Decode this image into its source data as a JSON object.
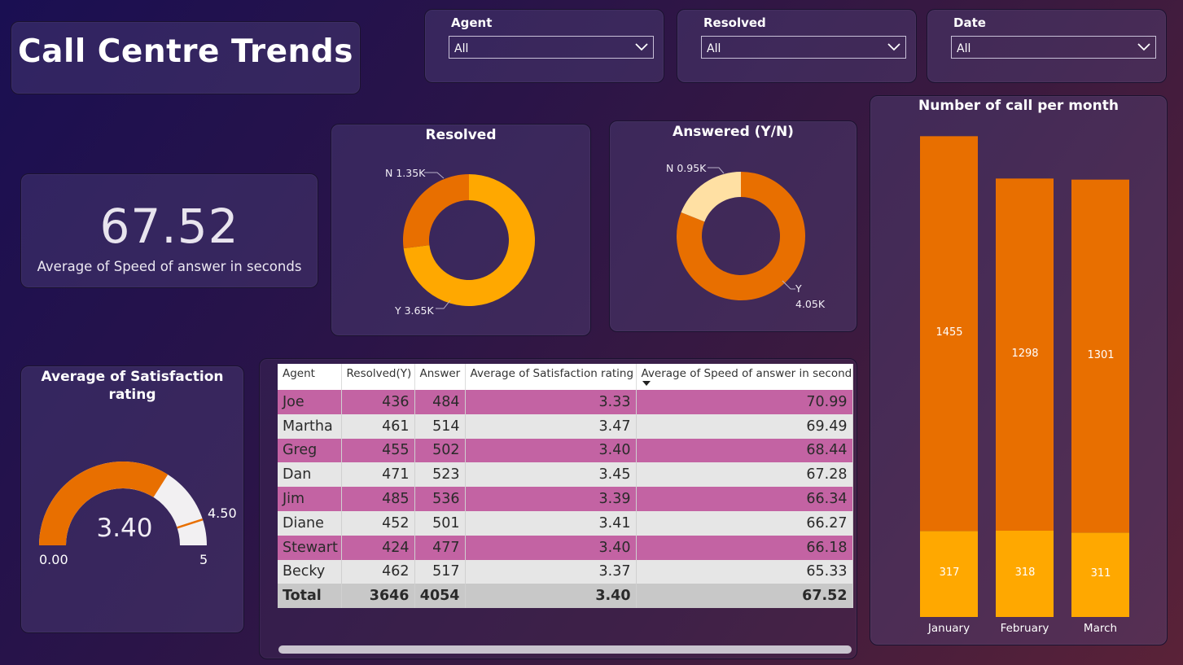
{
  "title": "Call Centre Trends",
  "slicers": [
    {
      "label": "Agent",
      "value": "All"
    },
    {
      "label": "Resolved",
      "value": "All"
    },
    {
      "label": "Date",
      "value": "All"
    }
  ],
  "kpi": {
    "value": "67.52",
    "caption": "Average of Speed of answer in seconds"
  },
  "resolved_chart": {
    "title": "Resolved",
    "label_n": "N 1.35K",
    "label_y": "Y 3.65K",
    "colors": {
      "N": "#e86f00",
      "Y": "#ffa800"
    }
  },
  "answered_chart": {
    "title": "Answered (Y/N)",
    "label_n": "N 0.95K",
    "label_y1": "Y",
    "label_y2": "4.05K",
    "colors": {
      "N": "#ffe0a3",
      "Y": "#e86f00"
    }
  },
  "gauge": {
    "title_line1": "Average of Satisfaction",
    "title_line2": "rating",
    "value": "3.40",
    "min": "0.00",
    "max": "5",
    "target": "4.50",
    "fill_color": "#e86f00"
  },
  "table": {
    "headers": [
      "Agent",
      "Resolved(Y)",
      "Answer",
      "Average of Satisfaction rating",
      "Average of Speed of answer in seconds"
    ],
    "rows": [
      [
        "Joe",
        "436",
        "484",
        "3.33",
        "70.99"
      ],
      [
        "Martha",
        "461",
        "514",
        "3.47",
        "69.49"
      ],
      [
        "Greg",
        "455",
        "502",
        "3.40",
        "68.44"
      ],
      [
        "Dan",
        "471",
        "523",
        "3.45",
        "67.28"
      ],
      [
        "Jim",
        "485",
        "536",
        "3.39",
        "66.34"
      ],
      [
        "Diane",
        "452",
        "501",
        "3.41",
        "66.27"
      ],
      [
        "Stewart",
        "424",
        "477",
        "3.40",
        "66.18"
      ],
      [
        "Becky",
        "462",
        "517",
        "3.37",
        "65.33"
      ]
    ],
    "total": [
      "Total",
      "3646",
      "4054",
      "3.40",
      "67.52"
    ]
  },
  "chart_data": [
    {
      "type": "pie",
      "title": "Resolved",
      "categories": [
        "N",
        "Y"
      ],
      "values": [
        1350,
        3650
      ]
    },
    {
      "type": "pie",
      "title": "Answered (Y/N)",
      "categories": [
        "N",
        "Y"
      ],
      "values": [
        950,
        4050
      ]
    },
    {
      "type": "bar",
      "title": "Number of call per month",
      "stacked": true,
      "categories": [
        "January",
        "February",
        "March"
      ],
      "series": [
        {
          "values": [
            317,
            318,
            311
          ],
          "color": "#ffa800"
        },
        {
          "values": [
            1455,
            1298,
            1301
          ],
          "color": "#e86f00"
        }
      ]
    }
  ]
}
